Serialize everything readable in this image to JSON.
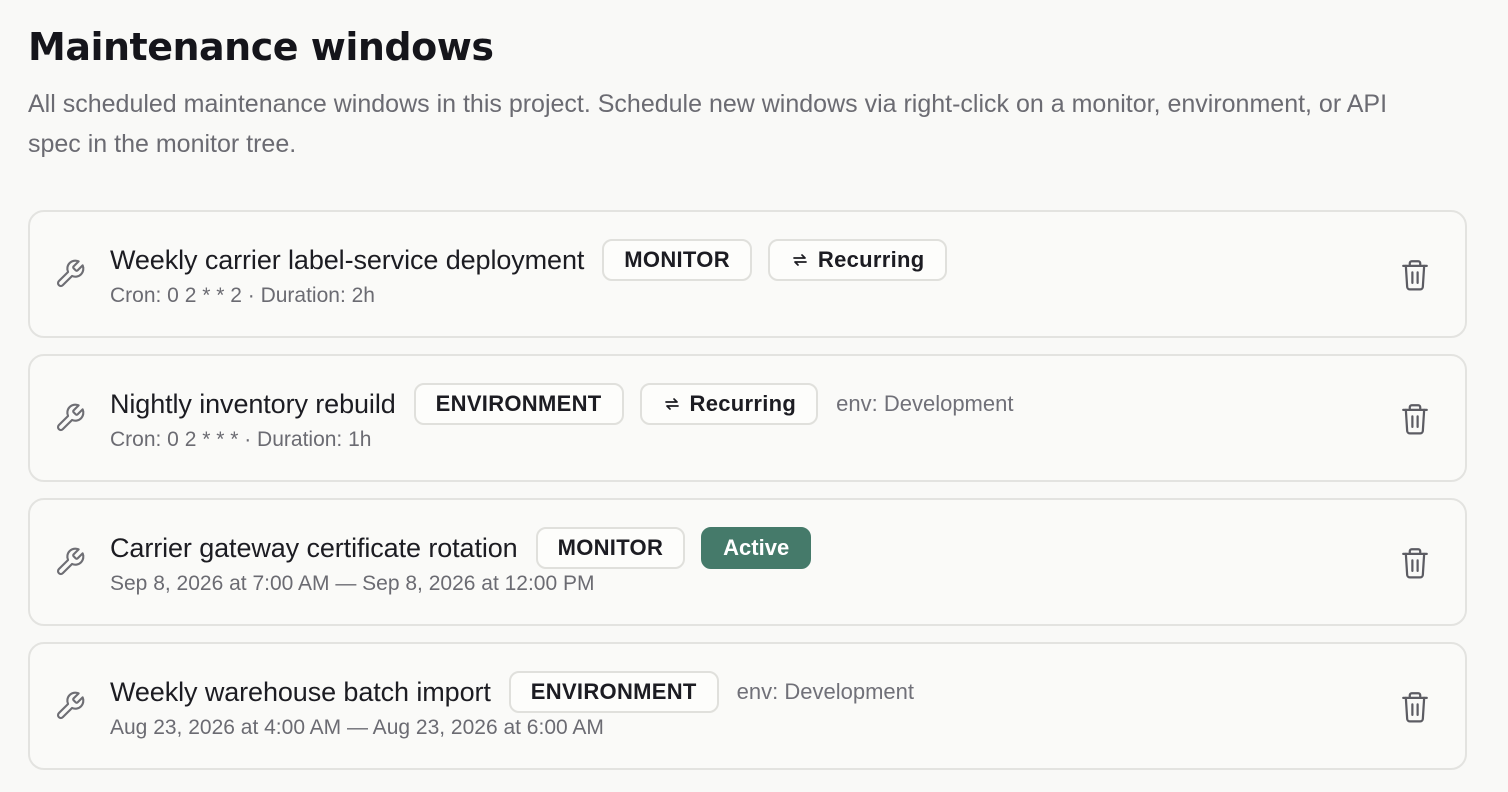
{
  "header": {
    "title": "Maintenance windows",
    "description": "All scheduled maintenance windows in this project. Schedule new windows via right-click on a monitor, environment, or API spec in the monitor tree."
  },
  "colors": {
    "background": "#f9f9f7",
    "active_badge": "#457a6a",
    "muted_text": "#6b6b72"
  },
  "windows": [
    {
      "icon": "wrench-icon",
      "title": "Weekly carrier label-service deployment",
      "scope": "MONITOR",
      "recurring": "Recurring",
      "active": "",
      "env": "",
      "meta": "Cron: 0 2 * * 2 · Duration: 2h"
    },
    {
      "icon": "wrench-icon",
      "title": "Nightly inventory rebuild",
      "scope": "ENVIRONMENT",
      "recurring": "Recurring",
      "active": "",
      "env": "env: Development",
      "meta": "Cron: 0 2 * * * · Duration: 1h"
    },
    {
      "icon": "wrench-icon",
      "title": "Carrier gateway certificate rotation",
      "scope": "MONITOR",
      "recurring": "",
      "active": "Active",
      "env": "",
      "meta": "Sep 8, 2026 at 7:00 AM — Sep 8, 2026 at 12:00 PM"
    },
    {
      "icon": "wrench-icon",
      "title": "Weekly warehouse batch import",
      "scope": "ENVIRONMENT",
      "recurring": "",
      "active": "",
      "env": "env: Development",
      "meta": "Aug 23, 2026 at 4:00 AM — Aug 23, 2026 at 6:00 AM"
    }
  ]
}
